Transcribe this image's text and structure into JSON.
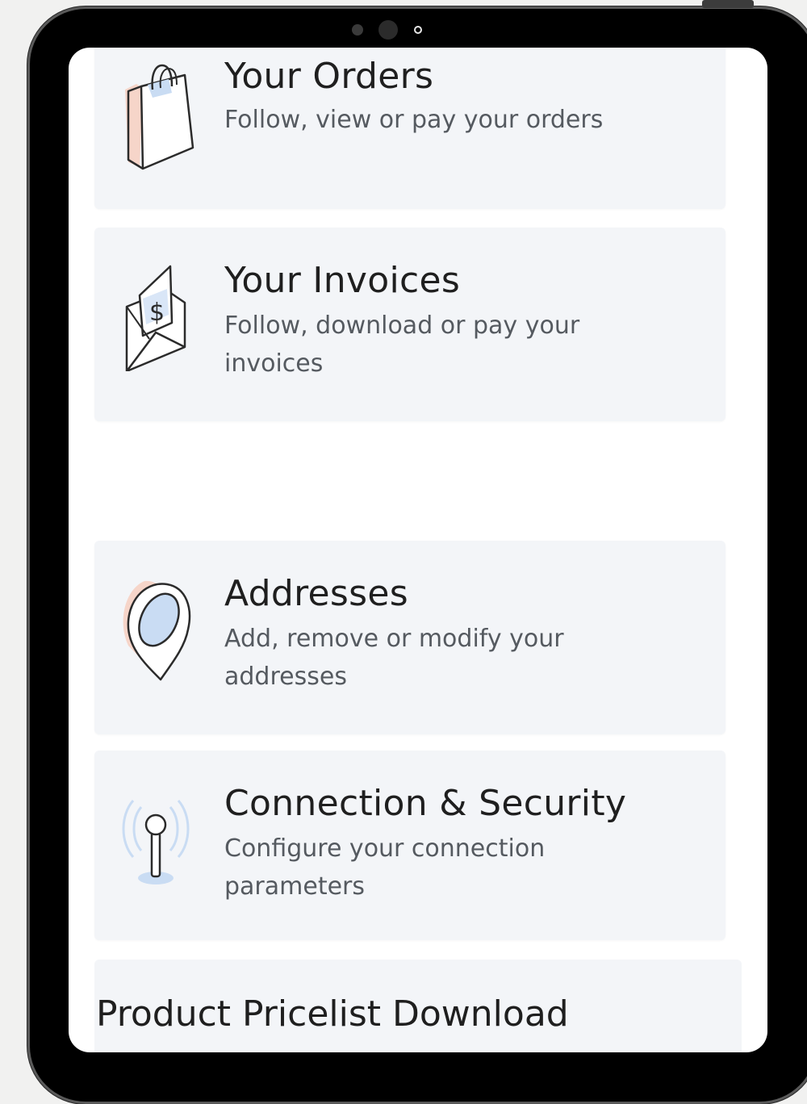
{
  "menu": {
    "orders": {
      "title": "Your Orders",
      "description": "Follow, view or pay your orders",
      "icon": "shopping-bag-icon"
    },
    "invoices": {
      "title": "Your Invoices",
      "description": "Follow, download or pay your invoices",
      "icon": "invoice-envelope-icon"
    },
    "addresses": {
      "title": "Addresses",
      "description": "Add, remove or modify your addresses",
      "icon": "location-pin-icon"
    },
    "security": {
      "title": "Connection & Security",
      "description": "Configure your connection parameters",
      "icon": "antenna-signal-icon"
    },
    "pricelist": {
      "title": "Product Pricelist Download"
    }
  },
  "colors": {
    "card_background": "#f3f5f8",
    "icon_accent_blue": "#c9dcf3",
    "icon_accent_peach": "#f6d5c9"
  }
}
